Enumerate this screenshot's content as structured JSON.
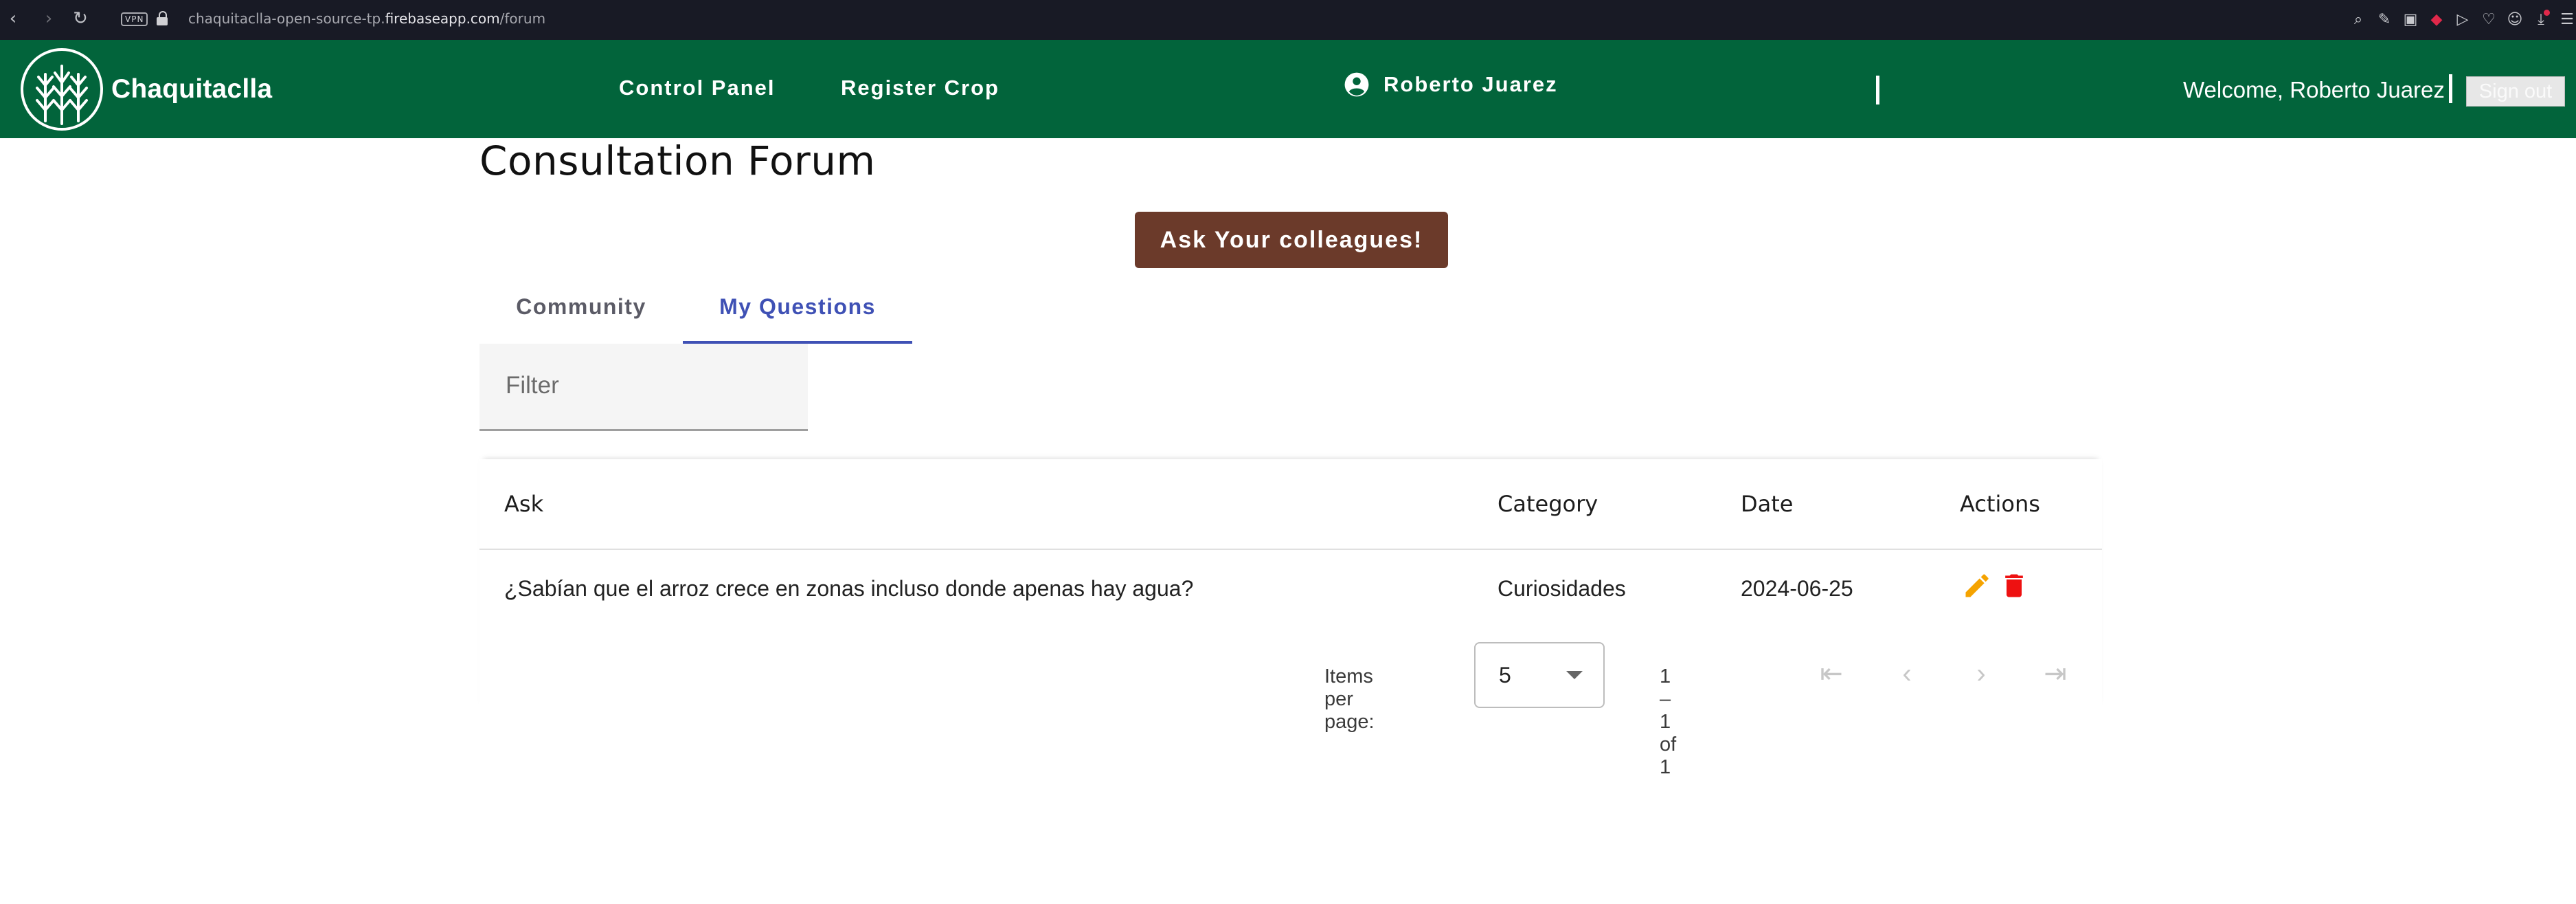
{
  "browser": {
    "url_prefix": "chaquitaclla-open-source-tp.",
    "url_host": "firebaseapp.com",
    "url_path": "/forum",
    "vpn_label": "VPN"
  },
  "header": {
    "brand": "Chaquitaclla",
    "nav": {
      "control_panel": "Control Panel",
      "register_crop": "Register Crop"
    },
    "user_name": "Roberto Juarez",
    "welcome": "Welcome, Roberto Juarez",
    "sign_out": "Sign out",
    "colors": {
      "header_bg": "#02643b"
    }
  },
  "page": {
    "title": "Consultation Forum",
    "ask_button": "Ask Your colleagues!",
    "tabs": [
      {
        "label": "Community"
      },
      {
        "label": "My Questions"
      }
    ],
    "active_tab": "My Questions",
    "filter_placeholder": "Filter"
  },
  "table": {
    "headers": {
      "ask": "Ask",
      "category": "Category",
      "date": "Date",
      "actions": "Actions"
    },
    "rows": [
      {
        "ask": "¿Sabían que el arroz crece en zonas incluso donde apenas hay agua?",
        "category": "Curiosidades",
        "date": "2024-06-25",
        "actions": [
          "edit-icon",
          "delete-icon"
        ]
      }
    ]
  },
  "paginator": {
    "items_per_page_label": "Items per page:",
    "items_per_page": "5",
    "range_label": "1 – 1 of 1"
  },
  "colors": {
    "ask_button": "#6b3a2a",
    "active_tab": "#3f51b5",
    "edit_icon": "#f5a300",
    "delete_icon": "#ee1111"
  }
}
